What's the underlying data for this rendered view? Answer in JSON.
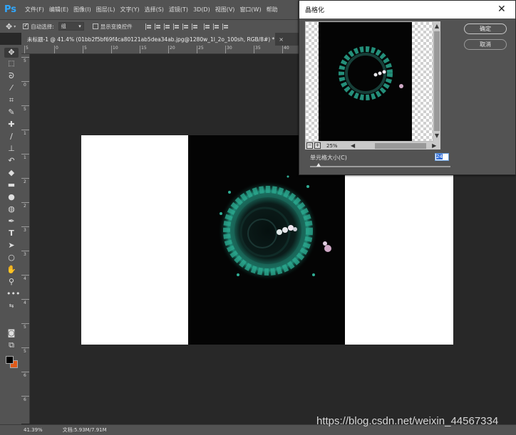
{
  "app": {
    "logo": "Ps",
    "menu": [
      "文件(F)",
      "编辑(E)",
      "图像(I)",
      "图层(L)",
      "文字(Y)",
      "选择(S)",
      "滤镜(T)",
      "3D(D)",
      "视图(V)",
      "窗口(W)",
      "帮助"
    ]
  },
  "options_bar": {
    "auto_select_label": "自动选择:",
    "auto_select_checked": true,
    "auto_select_value": "组",
    "show_transform_label": "显示变换控件",
    "show_transform_checked": false
  },
  "document": {
    "tab_title": "未标题-1 @ 41.4% (01bb2f5bf69f4ca80121ab5dea34ab.jpg@1280w_1l_2o_100sh, RGB/8#) *",
    "tab_close": "×",
    "ruler_top_ticks": [
      "5",
      "0",
      "5",
      "10",
      "15",
      "20",
      "25",
      "30",
      "35",
      "40",
      "45",
      "50",
      "55",
      "60",
      "65",
      "70"
    ],
    "ruler_left_ticks": [
      "5",
      "0",
      "5",
      "1",
      "1",
      "2",
      "2",
      "3",
      "3",
      "4",
      "4",
      "5",
      "5",
      "6",
      "6"
    ]
  },
  "status": {
    "zoom": "41.39%",
    "doc_info": "文档:5.93M/7.91M"
  },
  "watermark": "https://blog.csdn.net/weixin_44567334",
  "colors": {
    "foreground": "#000000",
    "background": "#e05a1a",
    "accent": "#31a8ff"
  },
  "tools": [
    "move-icon",
    "marquee-icon",
    "lasso-icon",
    "magic-wand-icon",
    "crop-icon",
    "eyedropper-icon",
    "healing-brush-icon",
    "brush-icon",
    "clone-stamp-icon",
    "history-brush-icon",
    "eraser-icon",
    "gradient-icon",
    "blur-icon",
    "dodge-icon",
    "pen-icon",
    "type-icon",
    "path-select-icon",
    "shape-icon",
    "hand-icon",
    "zoom-icon",
    "more-tools-icon",
    "quick-mask-icon",
    "screen-mode-icon"
  ],
  "dialog": {
    "title": "晶格化",
    "ok_label": "确定",
    "cancel_label": "取消",
    "zoom": "25%",
    "cell_size_label": "单元格大小(C)",
    "cell_size_value": "24",
    "cell_size_slider": 0.06
  }
}
